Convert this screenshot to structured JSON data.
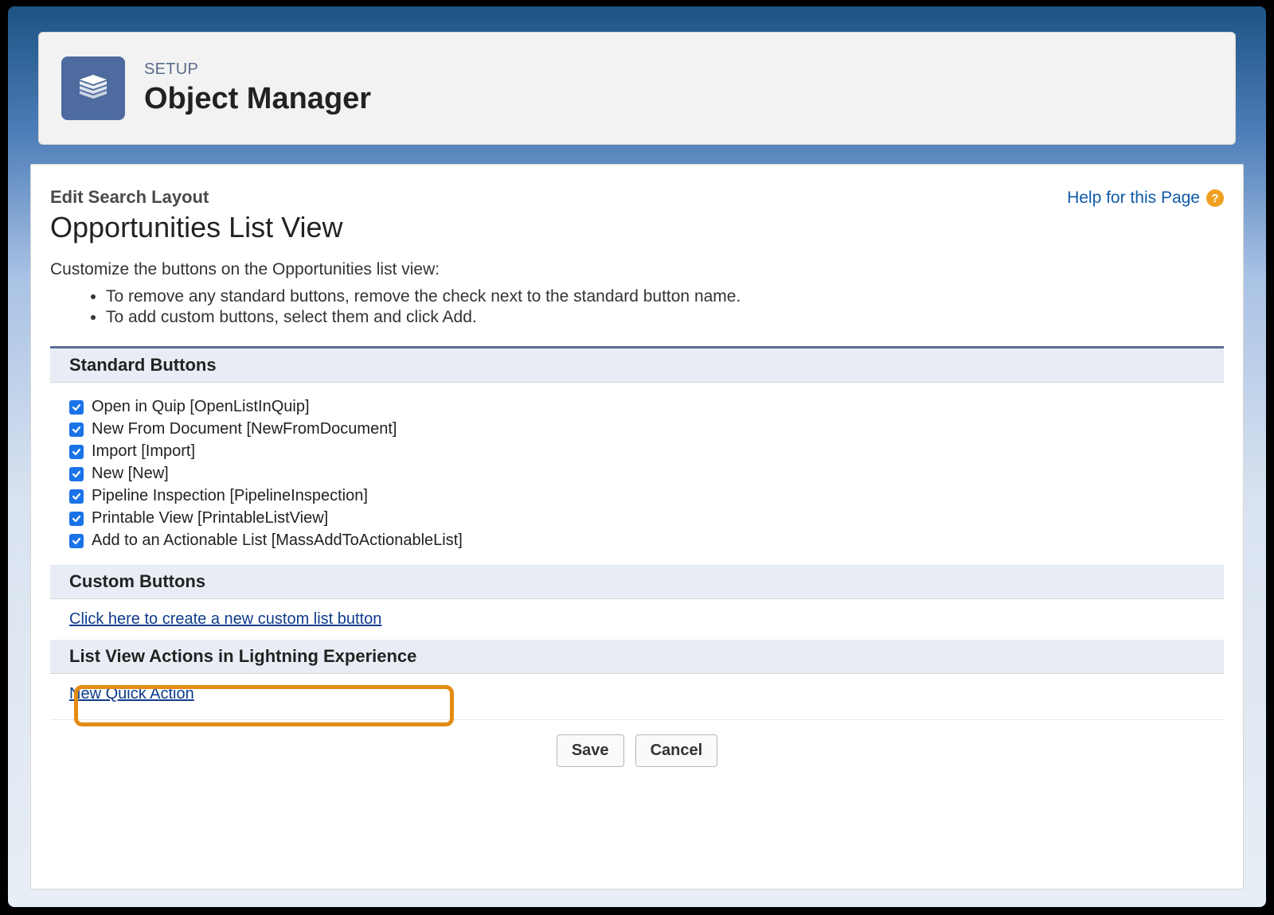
{
  "header": {
    "setup_label": "SETUP",
    "title": "Object Manager"
  },
  "page": {
    "edit_label": "Edit Search Layout",
    "title": "Opportunities List View",
    "help_label": "Help for this Page",
    "intro": "Customize the buttons on the Opportunities list view:",
    "bullets": [
      "To remove any standard buttons, remove the check next to the standard button name.",
      "To add custom buttons, select them and click Add."
    ]
  },
  "sections": {
    "standard": {
      "title": "Standard Buttons",
      "items": [
        {
          "label": "Open in Quip [OpenListInQuip]",
          "checked": true,
          "highlight": false
        },
        {
          "label": "New From Document [NewFromDocument]",
          "checked": true,
          "highlight": false
        },
        {
          "label": "Import [Import]",
          "checked": true,
          "highlight": false
        },
        {
          "label": "New [New]",
          "checked": true,
          "highlight": false
        },
        {
          "label": "Pipeline Inspection [PipelineInspection]",
          "checked": true,
          "highlight": true
        },
        {
          "label": "Printable View [PrintableListView]",
          "checked": true,
          "highlight": false
        },
        {
          "label": "Add to an Actionable List [MassAddToActionableList]",
          "checked": true,
          "highlight": false
        }
      ]
    },
    "custom": {
      "title": "Custom Buttons",
      "link": "Click here to create a new custom list button"
    },
    "actions": {
      "title": "List View Actions in Lightning Experience",
      "link": "New Quick Action"
    }
  },
  "buttons": {
    "save": "Save",
    "cancel": "Cancel"
  }
}
